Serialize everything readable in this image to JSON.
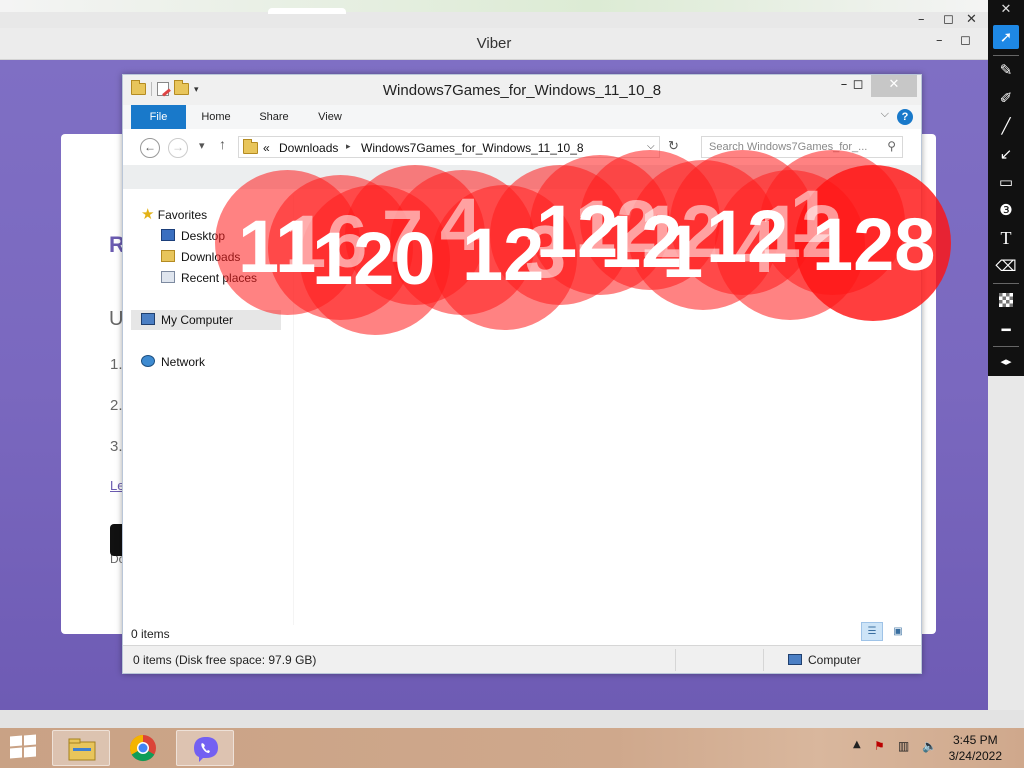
{
  "outer": {
    "window_title": "Viber",
    "controls": {
      "minimize": "–",
      "maximize": "◻",
      "close": "✕"
    }
  },
  "viber_card": {
    "fragments": [
      {
        "name": "heading-fragment",
        "text": "R"
      },
      {
        "name": "subheading-fragment",
        "text": "U"
      },
      {
        "name": "step-1-fragment",
        "text": "1."
      },
      {
        "name": "step-2-fragment",
        "text": "2."
      },
      {
        "name": "step-3-fragment",
        "text": "3."
      },
      {
        "name": "link-fragment",
        "text": "Le"
      },
      {
        "name": "download-line-1-fragment",
        "text": "Do"
      },
      {
        "name": "download-line-2-fragment",
        "text": "Do"
      }
    ]
  },
  "explorer": {
    "title": "Windows7Games_for_Windows_11_10_8",
    "ribbon_tabs": [
      "File",
      "Home",
      "Share",
      "View"
    ],
    "help_label": "?",
    "address": {
      "prefix": "«",
      "segments": [
        "Downloads",
        "Windows7Games_for_Windows_11_10_8"
      ]
    },
    "search_placeholder": "Search Windows7Games_for_...",
    "nav": {
      "favorites_label": "Favorites",
      "favorites": [
        "Desktop",
        "Downloads",
        "Recent places"
      ],
      "computer_label": "My Computer",
      "network_label": "Network"
    },
    "item_count": "0 items",
    "details_status": "0 items (Disk free space: 97.9 GB)",
    "details_location": "Computer"
  },
  "bubble_numbers": [
    "11",
    "120",
    "12",
    "12",
    "12",
    "1",
    "12",
    "128"
  ],
  "ghost_numbers": [
    "16",
    "7",
    "4",
    "3",
    "12",
    "12",
    "4",
    "1",
    "12"
  ],
  "annotation_toolbar": {
    "close_label": "✕",
    "tools": [
      "pointer",
      "pencil",
      "highlighter",
      "line",
      "arrow",
      "rectangle",
      "numbering",
      "text",
      "eraser",
      "opacity",
      "line-width",
      "expand"
    ],
    "text_tool_glyph": "T"
  },
  "taskbar": {
    "apps": [
      "File Explorer",
      "Google Chrome",
      "Viber"
    ],
    "time": "3:45 PM",
    "date": "3/24/2022"
  },
  "colors": {
    "viber_purple": "#7a68bf",
    "ribbon_file_blue": "#1979ca",
    "bubble_red": "#ff1c1c",
    "annotation_active": "#1e88e5"
  }
}
